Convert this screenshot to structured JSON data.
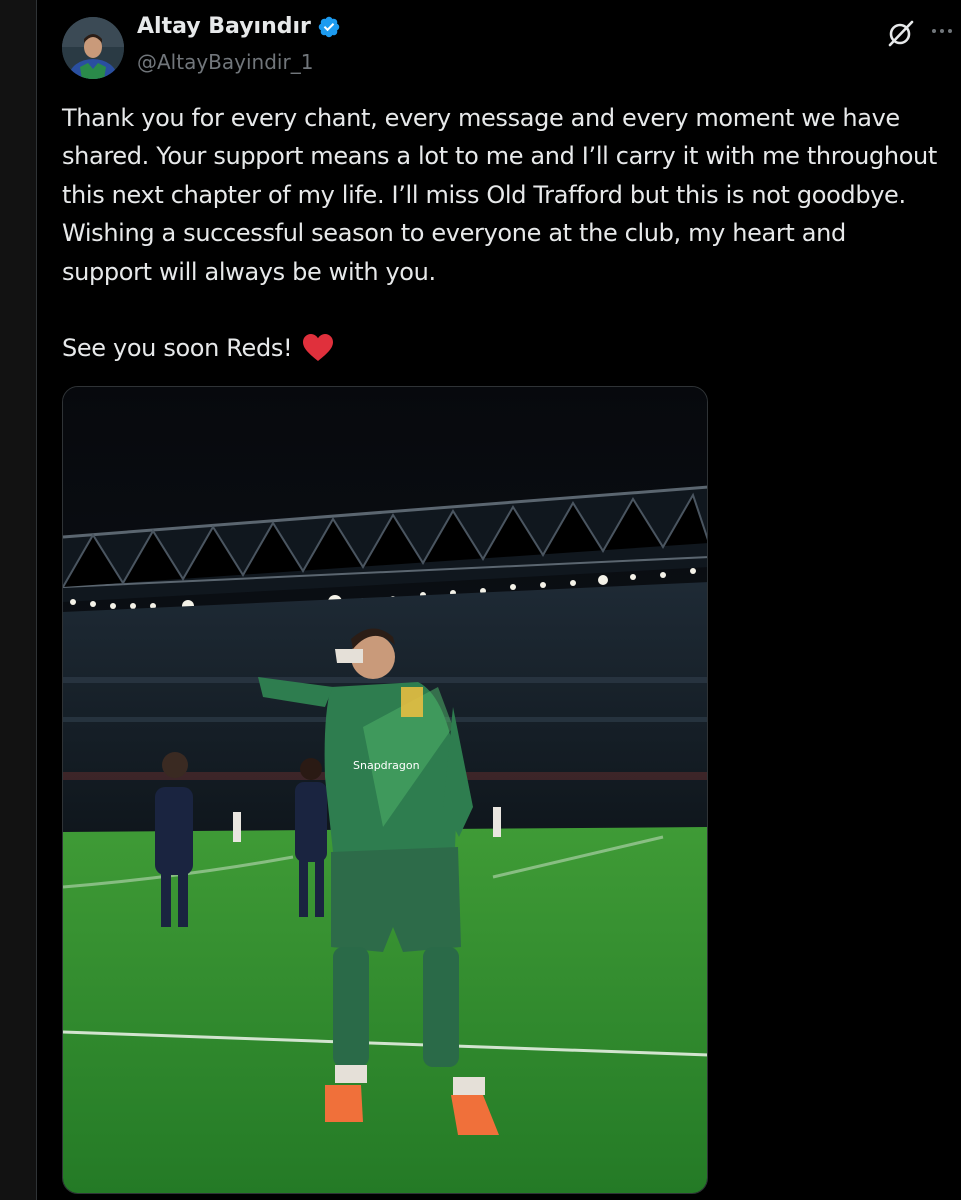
{
  "author": {
    "display_name": "Altay Bayındır",
    "handle": "@AltayBayindir_1",
    "verified": true,
    "verified_badge_color": "#1d9bf0"
  },
  "actions": {
    "grok_icon": "grok-icon",
    "more_icon": "more-dots-icon"
  },
  "tweet": {
    "paragraph_1": "Thank you for every chant, every message and every moment we have shared. Your support means a lot to me and I’ll carry it with me throughout this next chapter of my life. I’ll miss Old Trafford but this is not goodbye. Wishing a successful season to everyone at the club, my heart and support will always be with you.",
    "closing": "See you soon Reds!",
    "closing_emoji": "red-heart",
    "heart_color": "#e0303c"
  },
  "media": {
    "kit_sponsor_text": "Snapdragon",
    "colors": {
      "pitch": "#2f8a2c",
      "kit": "#2e7d4f",
      "boots": "#f0703a"
    }
  },
  "theme": {
    "background": "#000000",
    "text_primary": "#e7e9ea",
    "text_secondary": "#71767b"
  }
}
